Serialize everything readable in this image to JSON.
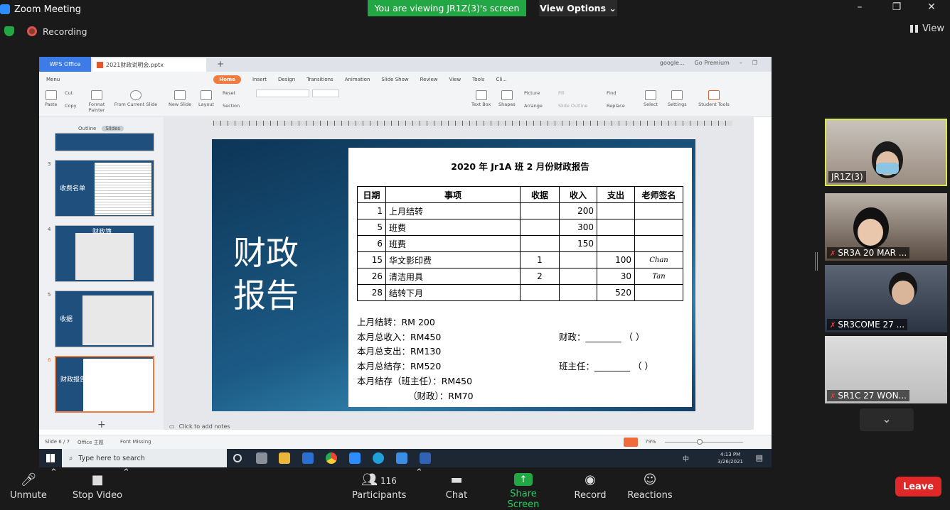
{
  "zoom": {
    "window_title": "Zoom Meeting",
    "banner": "You are viewing JR1Z(3)'s screen",
    "view_options": "View Options ⌄",
    "recording": "Recording",
    "view": "View"
  },
  "wps": {
    "office_tab": "WPS Office",
    "file_tab": "2021财政说明会.pptx",
    "google": "google...",
    "premium": "Go Premium",
    "menu": [
      "Menu",
      "Home",
      "Insert",
      "Design",
      "Transitions",
      "Animation",
      "Slide Show",
      "Review",
      "View",
      "Tools",
      "Cli..."
    ],
    "ribbon": {
      "paste": "Paste",
      "cut": "Cut",
      "copy": "Copy",
      "format_painter": "Format Painter",
      "from_current": "From Current Slide",
      "new_slide": "New Slide",
      "layout": "Layout",
      "reset": "Reset",
      "section": "Section",
      "text_box": "Text Box",
      "shapes": "Shapes",
      "picture": "Picture",
      "arrange": "Arrange",
      "fill": "Fill",
      "slide_outline": "Slide Outline",
      "find": "Find",
      "replace": "Replace",
      "select": "Select",
      "settings": "Settings",
      "student_tools": "Student Tools"
    },
    "panel": {
      "outline": "Outline",
      "slides": "Slides"
    },
    "thumbs": [
      {
        "num": "3",
        "label": "收费名单"
      },
      {
        "num": "4",
        "label": "财政簿"
      },
      {
        "num": "5",
        "label": "收据"
      },
      {
        "num": "6",
        "label": "财政报告"
      }
    ],
    "notes": "Click to add notes",
    "status": {
      "slide": "Slide 6 / 7",
      "theme": "Office 主题",
      "font": "Font Missing",
      "zoom": "79%"
    }
  },
  "slide": {
    "title_line1": "财政",
    "title_line2": "报告",
    "report_title": "2020 年 Jr1A 班 2 月份财政报告",
    "table_headers": [
      "日期",
      "事项",
      "收据",
      "收入",
      "支出",
      "老师签名"
    ],
    "table_rows": [
      [
        "1",
        "上月结转",
        "",
        "200",
        "",
        ""
      ],
      [
        "5",
        "班费",
        "",
        "300",
        "",
        ""
      ],
      [
        "6",
        "班费",
        "",
        "150",
        "",
        ""
      ],
      [
        "15",
        "华文影印费",
        "1",
        "",
        "100",
        "Chan"
      ],
      [
        "26",
        "清洁用具",
        "2",
        "",
        "30",
        "Tan"
      ],
      [
        "28",
        "结转下月",
        "",
        "",
        "520",
        ""
      ]
    ],
    "summary": {
      "carry_in": "上月结转：RM 200",
      "total_income": "本月总收入：RM450",
      "total_expense": "本月总支出：RM130",
      "total_balance": "本月总结存：RM520",
      "balance_teacher": "本月结存（班主任）：RM450",
      "balance_treasurer": "（财政）：RM70",
      "sign_treasurer": "财政：________ （      ）",
      "sign_teacher": "班主任：________ （        ）"
    }
  },
  "taskbar": {
    "search_placeholder": "Type here to search",
    "time": "4:13 PM",
    "date": "3/26/2021",
    "ime": "中"
  },
  "participants_tiles": [
    {
      "name": "JR1Z(3)",
      "muted": false
    },
    {
      "name": "SR3A 20 MAR ...",
      "muted": true
    },
    {
      "name": "SR3COME 27 ...",
      "muted": true
    },
    {
      "name": "SR1C 27 WON...",
      "muted": true
    }
  ],
  "toolbar": {
    "unmute": "Unmute",
    "stop_video": "Stop Video",
    "participants": "Participants",
    "participants_count": "116",
    "chat": "Chat",
    "share_screen": "Share Screen",
    "record": "Record",
    "reactions": "Reactions",
    "leave": "Leave"
  }
}
